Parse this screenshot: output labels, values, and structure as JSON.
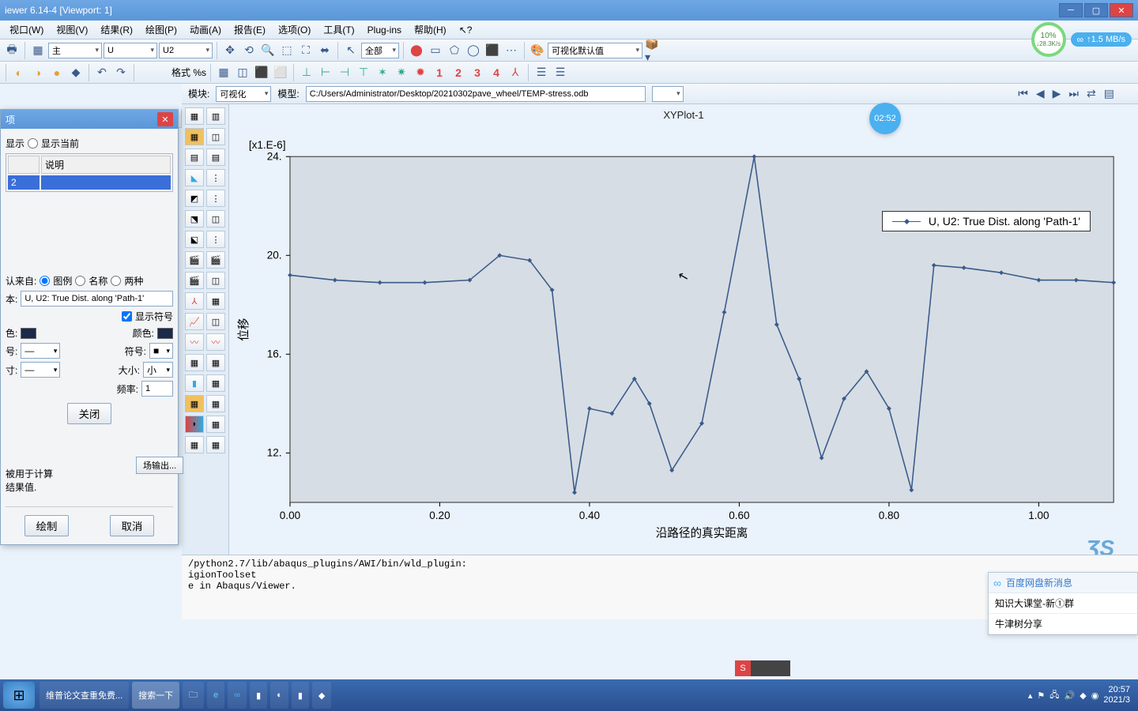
{
  "window": {
    "title": "iewer 6.14-4  [Viewport: 1]"
  },
  "menu": [
    "视口(W)",
    "视图(V)",
    "结果(R)",
    "绘图(P)",
    "动画(A)",
    "报告(E)",
    "选项(O)",
    "工具(T)",
    "Plug-ins",
    "帮助(H)"
  ],
  "net": {
    "pct": "10%",
    "rate": "↓28.3K/s",
    "badge": "↑1.5 MB/s"
  },
  "combo1": "主",
  "combo2": "U",
  "combo3": "U2",
  "fmt_label": "格式 %s",
  "num_icons": [
    "1",
    "2",
    "3",
    "4"
  ],
  "module_label": "模块:",
  "module_val": "可视化",
  "model_label": "模型:",
  "model_path": "C:/Users/Administrator/Desktop/20210302pave_wheel/TEMP-stress.odb",
  "plot": {
    "title": "XYPlot-1",
    "ylabel": "位移",
    "xlabel": "沿路径的真实距离",
    "exp": "[x1.E-6]",
    "legend": "U, U2: True Dist. along 'Path-1'"
  },
  "time_badge": "02:52",
  "dialog": {
    "title": "项",
    "show_label": "显示",
    "show_current": "显示当前",
    "col2": "说明",
    "row1": "2",
    "from_label": "认来自:",
    "opt_legend": "图例",
    "opt_name": "名称",
    "opt_both": "两种",
    "text_label": "本:",
    "text_val": "U, U2: True Dist. along 'Path-1'",
    "showsym": "显示符号",
    "color_label": "色:",
    "ycolor_label": "颜色:",
    "sym_label": "号:",
    "sym2_label": "符号:",
    "size_label": "寸:",
    "size2_label": "大小:",
    "size_val": "小",
    "freq_label": "频率:",
    "freq_val": "1",
    "close": "关闭",
    "fieldout": "场输出...",
    "msg1": "被用于计算",
    "msg2": "结果值.",
    "plot_btn": "绘制",
    "cancel_btn": "取消"
  },
  "cli": "/python2.7/lib/abaqus_plugins/AWI/bin/wld_plugin:\nigionToolset\ne in Abaqus/Viewer.",
  "notif": {
    "hdr": "百度网盘新消息",
    "i1": "知识大课堂-新①群",
    "i2": "牛津树分享"
  },
  "taskbar": {
    "t1": "维普论文查重免费...",
    "t2": "搜索一下"
  },
  "tray": {
    "time": "20:57",
    "date": "2021/3"
  },
  "chart_data": {
    "type": "line",
    "title": "XYPlot-1",
    "xlabel": "沿路径的真实距离",
    "ylabel": "位移 [x1.E-6]",
    "xlim": [
      0.0,
      1.1
    ],
    "ylim": [
      10,
      24
    ],
    "x_ticks": [
      0.0,
      0.2,
      0.4,
      0.6,
      0.8,
      1.0
    ],
    "y_ticks": [
      12,
      16,
      20,
      24
    ],
    "series": [
      {
        "name": "U, U2: True Dist. along 'Path-1'",
        "x": [
          0.0,
          0.06,
          0.12,
          0.18,
          0.24,
          0.28,
          0.32,
          0.35,
          0.38,
          0.4,
          0.43,
          0.46,
          0.48,
          0.51,
          0.55,
          0.58,
          0.62,
          0.65,
          0.68,
          0.71,
          0.74,
          0.77,
          0.8,
          0.83,
          0.86,
          0.9,
          0.95,
          1.0,
          1.05,
          1.1
        ],
        "y": [
          19.2,
          19.0,
          18.9,
          18.9,
          19.0,
          20.0,
          19.8,
          18.6,
          10.4,
          13.8,
          13.6,
          15.0,
          14.0,
          11.3,
          13.2,
          17.7,
          24.0,
          17.2,
          15.0,
          11.8,
          14.2,
          15.3,
          13.8,
          10.5,
          19.6,
          19.5,
          19.3,
          19.0,
          19.0,
          18.9
        ]
      }
    ]
  }
}
